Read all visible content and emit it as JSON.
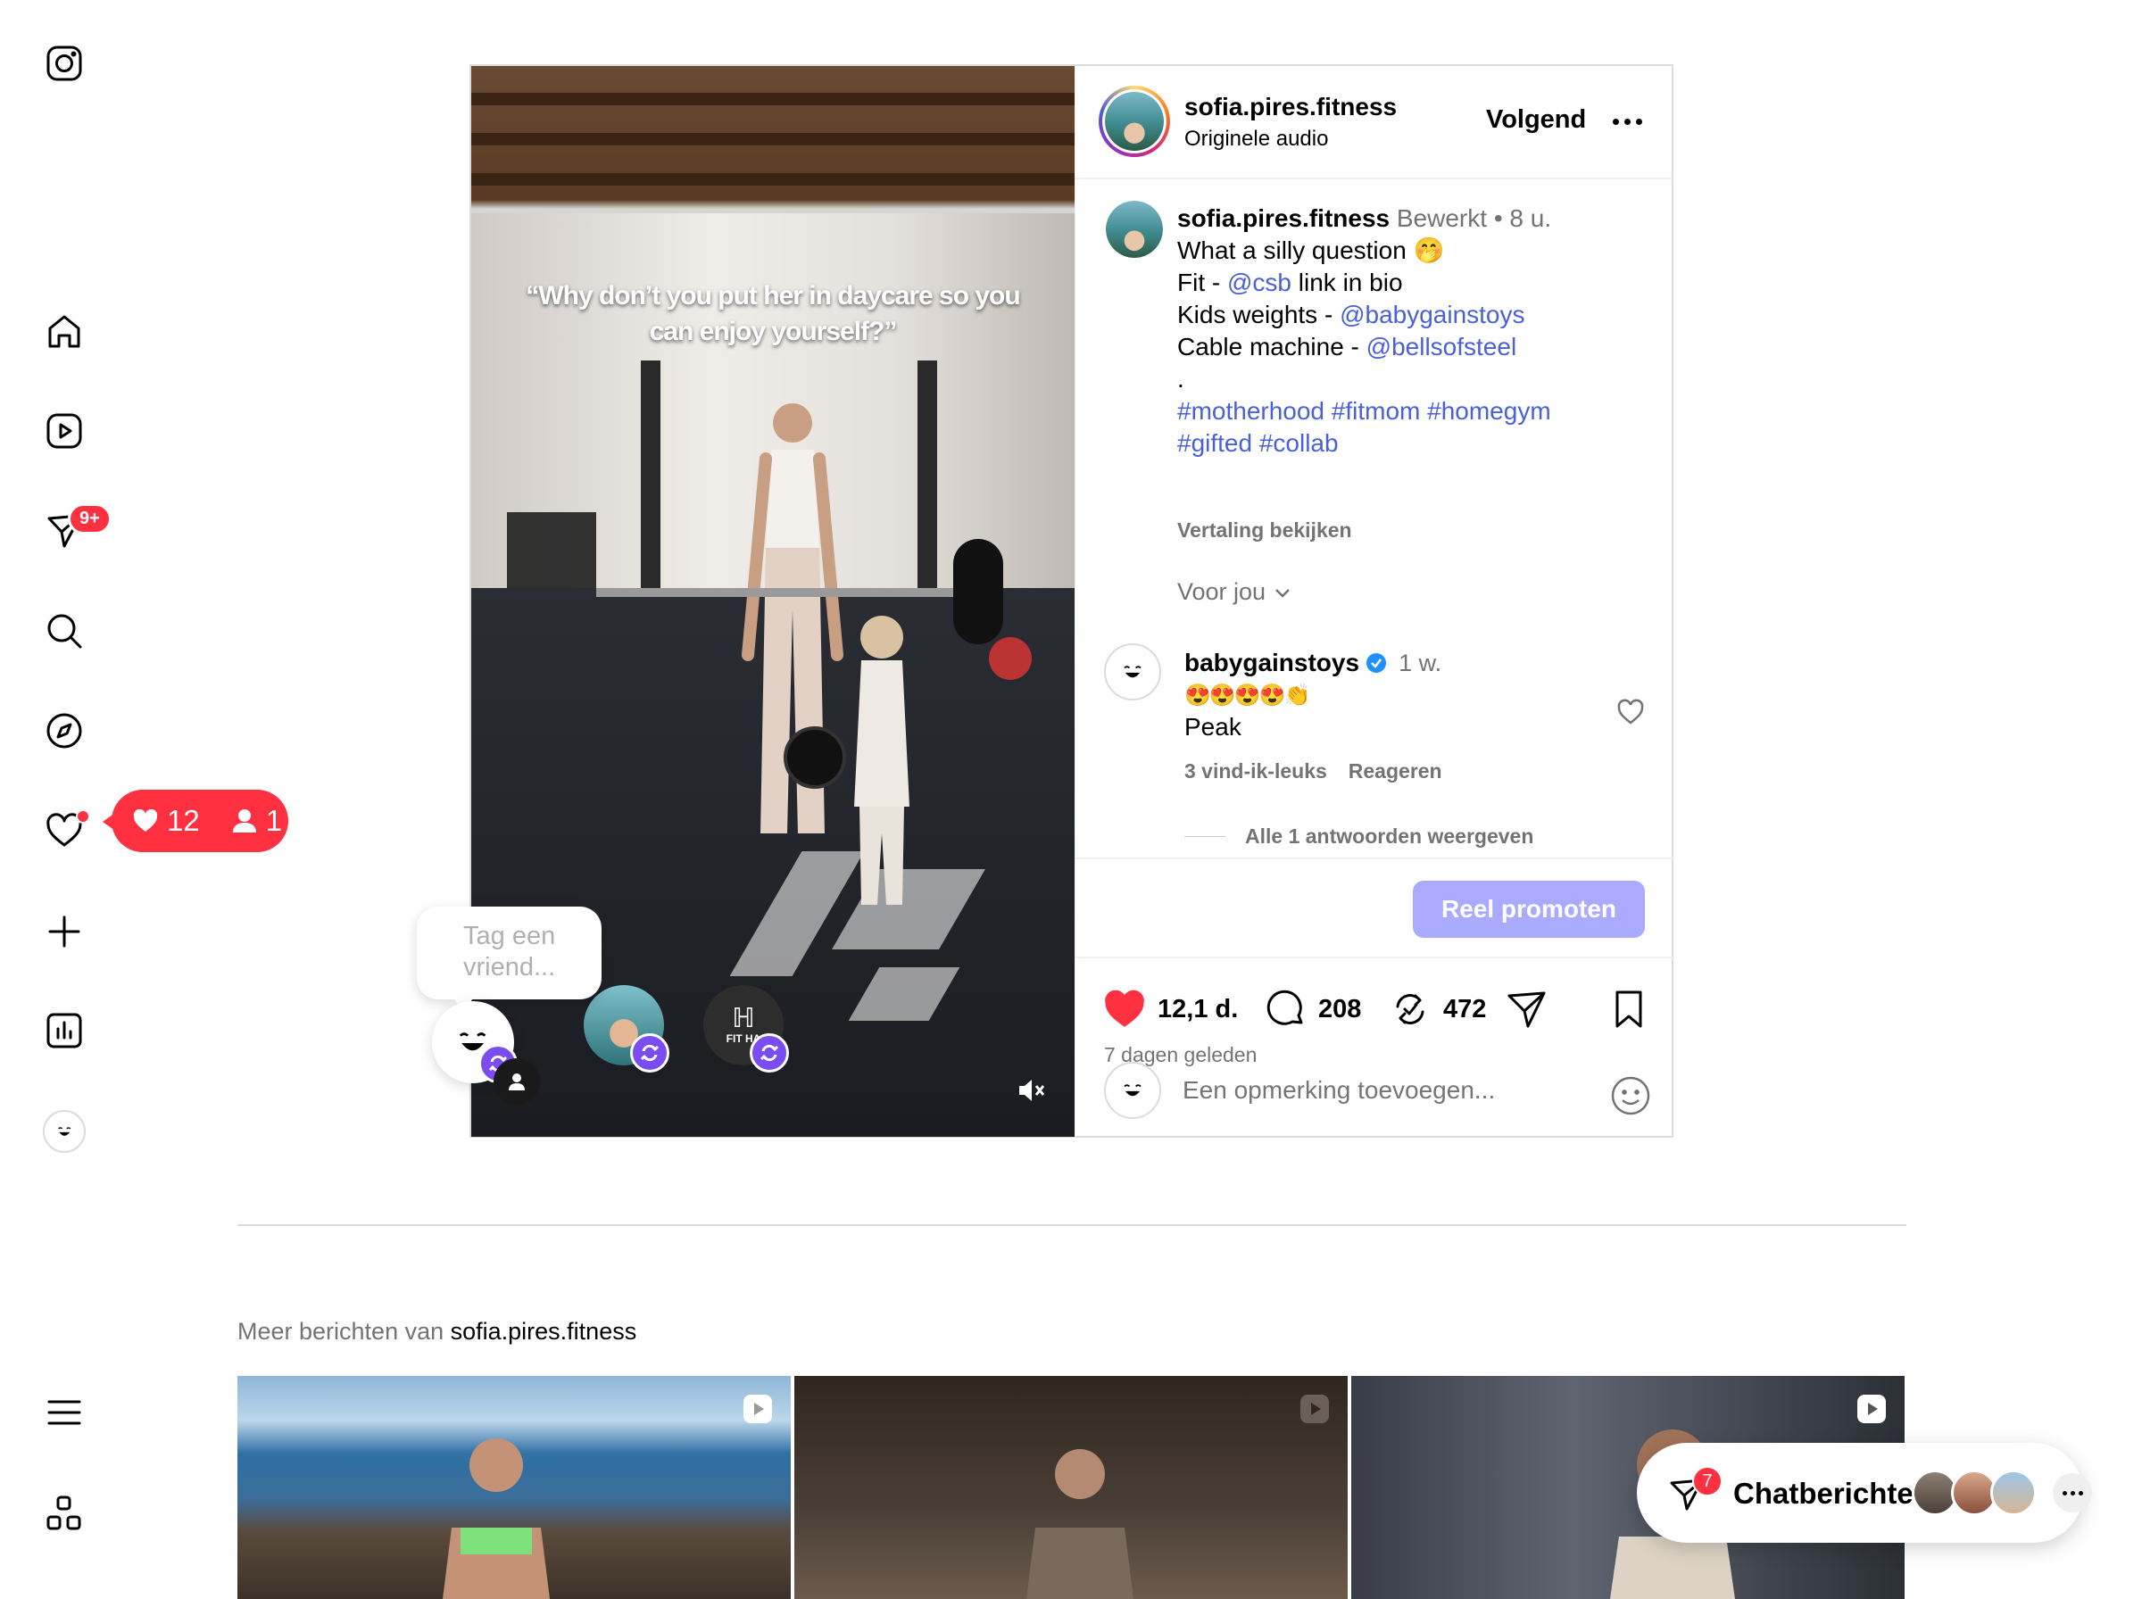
{
  "sidebar": {
    "items": [
      {
        "name": "home",
        "label": "Home"
      },
      {
        "name": "reels",
        "label": "Reels"
      },
      {
        "name": "messages",
        "label": "Messages",
        "badge": "9+"
      },
      {
        "name": "search",
        "label": "Search"
      },
      {
        "name": "explore",
        "label": "Explore"
      },
      {
        "name": "notifications",
        "label": "Notifications"
      },
      {
        "name": "create",
        "label": "Create"
      },
      {
        "name": "dashboard",
        "label": "Dashboard"
      },
      {
        "name": "profile",
        "label": "Profile"
      }
    ],
    "messages_badge": "9+",
    "notif_likes": "12",
    "notif_follows": "1"
  },
  "post": {
    "username": "sofia.pires.fitness",
    "audio": "Originele audio",
    "follow_label": "Volgend",
    "overlay_quote": "“Why don’t you put her in daycare so you can enjoy yourself?”",
    "collab_label": "FIT HA",
    "tag_prompt": "Tag een vriend...",
    "caption": {
      "username": "sofia.pires.fitness",
      "edited": "Bewerkt",
      "time": "8 u.",
      "line1": "What a silly question 🤭",
      "line2_pre": "Fit - ",
      "line2_link": "@csb",
      "line2_post": " link in bio",
      "line3_pre": "Kids weights - ",
      "line3_link": "@babygainstoys",
      "line4_pre": "Cable machine - ",
      "line4_link": "@bellsofsteel",
      "line5": ".",
      "hashtags1": "#motherhood #fitmom #homegym",
      "hashtags2": "#gifted #collab",
      "translate": "Vertaling bekijken"
    },
    "sort_label": "Voor jou",
    "comment": {
      "username": "babygainstoys",
      "time": "1 w.",
      "emoji": "😍😍😍😍👏",
      "body": "Peak",
      "likes": "3 vind-ik-leuks",
      "reply": "Reageren",
      "view_replies": "Alle 1 antwoorden weergeven"
    },
    "promote_label": "Reel promoten",
    "likes": "12,1 d.",
    "comments": "208",
    "reposts": "472",
    "posted": "7 dagen geleden",
    "comment_placeholder": "Een opmerking toevoegen..."
  },
  "more": {
    "prefix": "Meer berichten van ",
    "username": "sofia.pires.fitness"
  },
  "chat": {
    "label": "Chatberichten",
    "badge": "7"
  },
  "colors": {
    "accent_red": "#ff3040",
    "link_blue": "#4a5fd8",
    "promote_button": "#aaaaff",
    "collab_purple": "#7b4cf0"
  }
}
